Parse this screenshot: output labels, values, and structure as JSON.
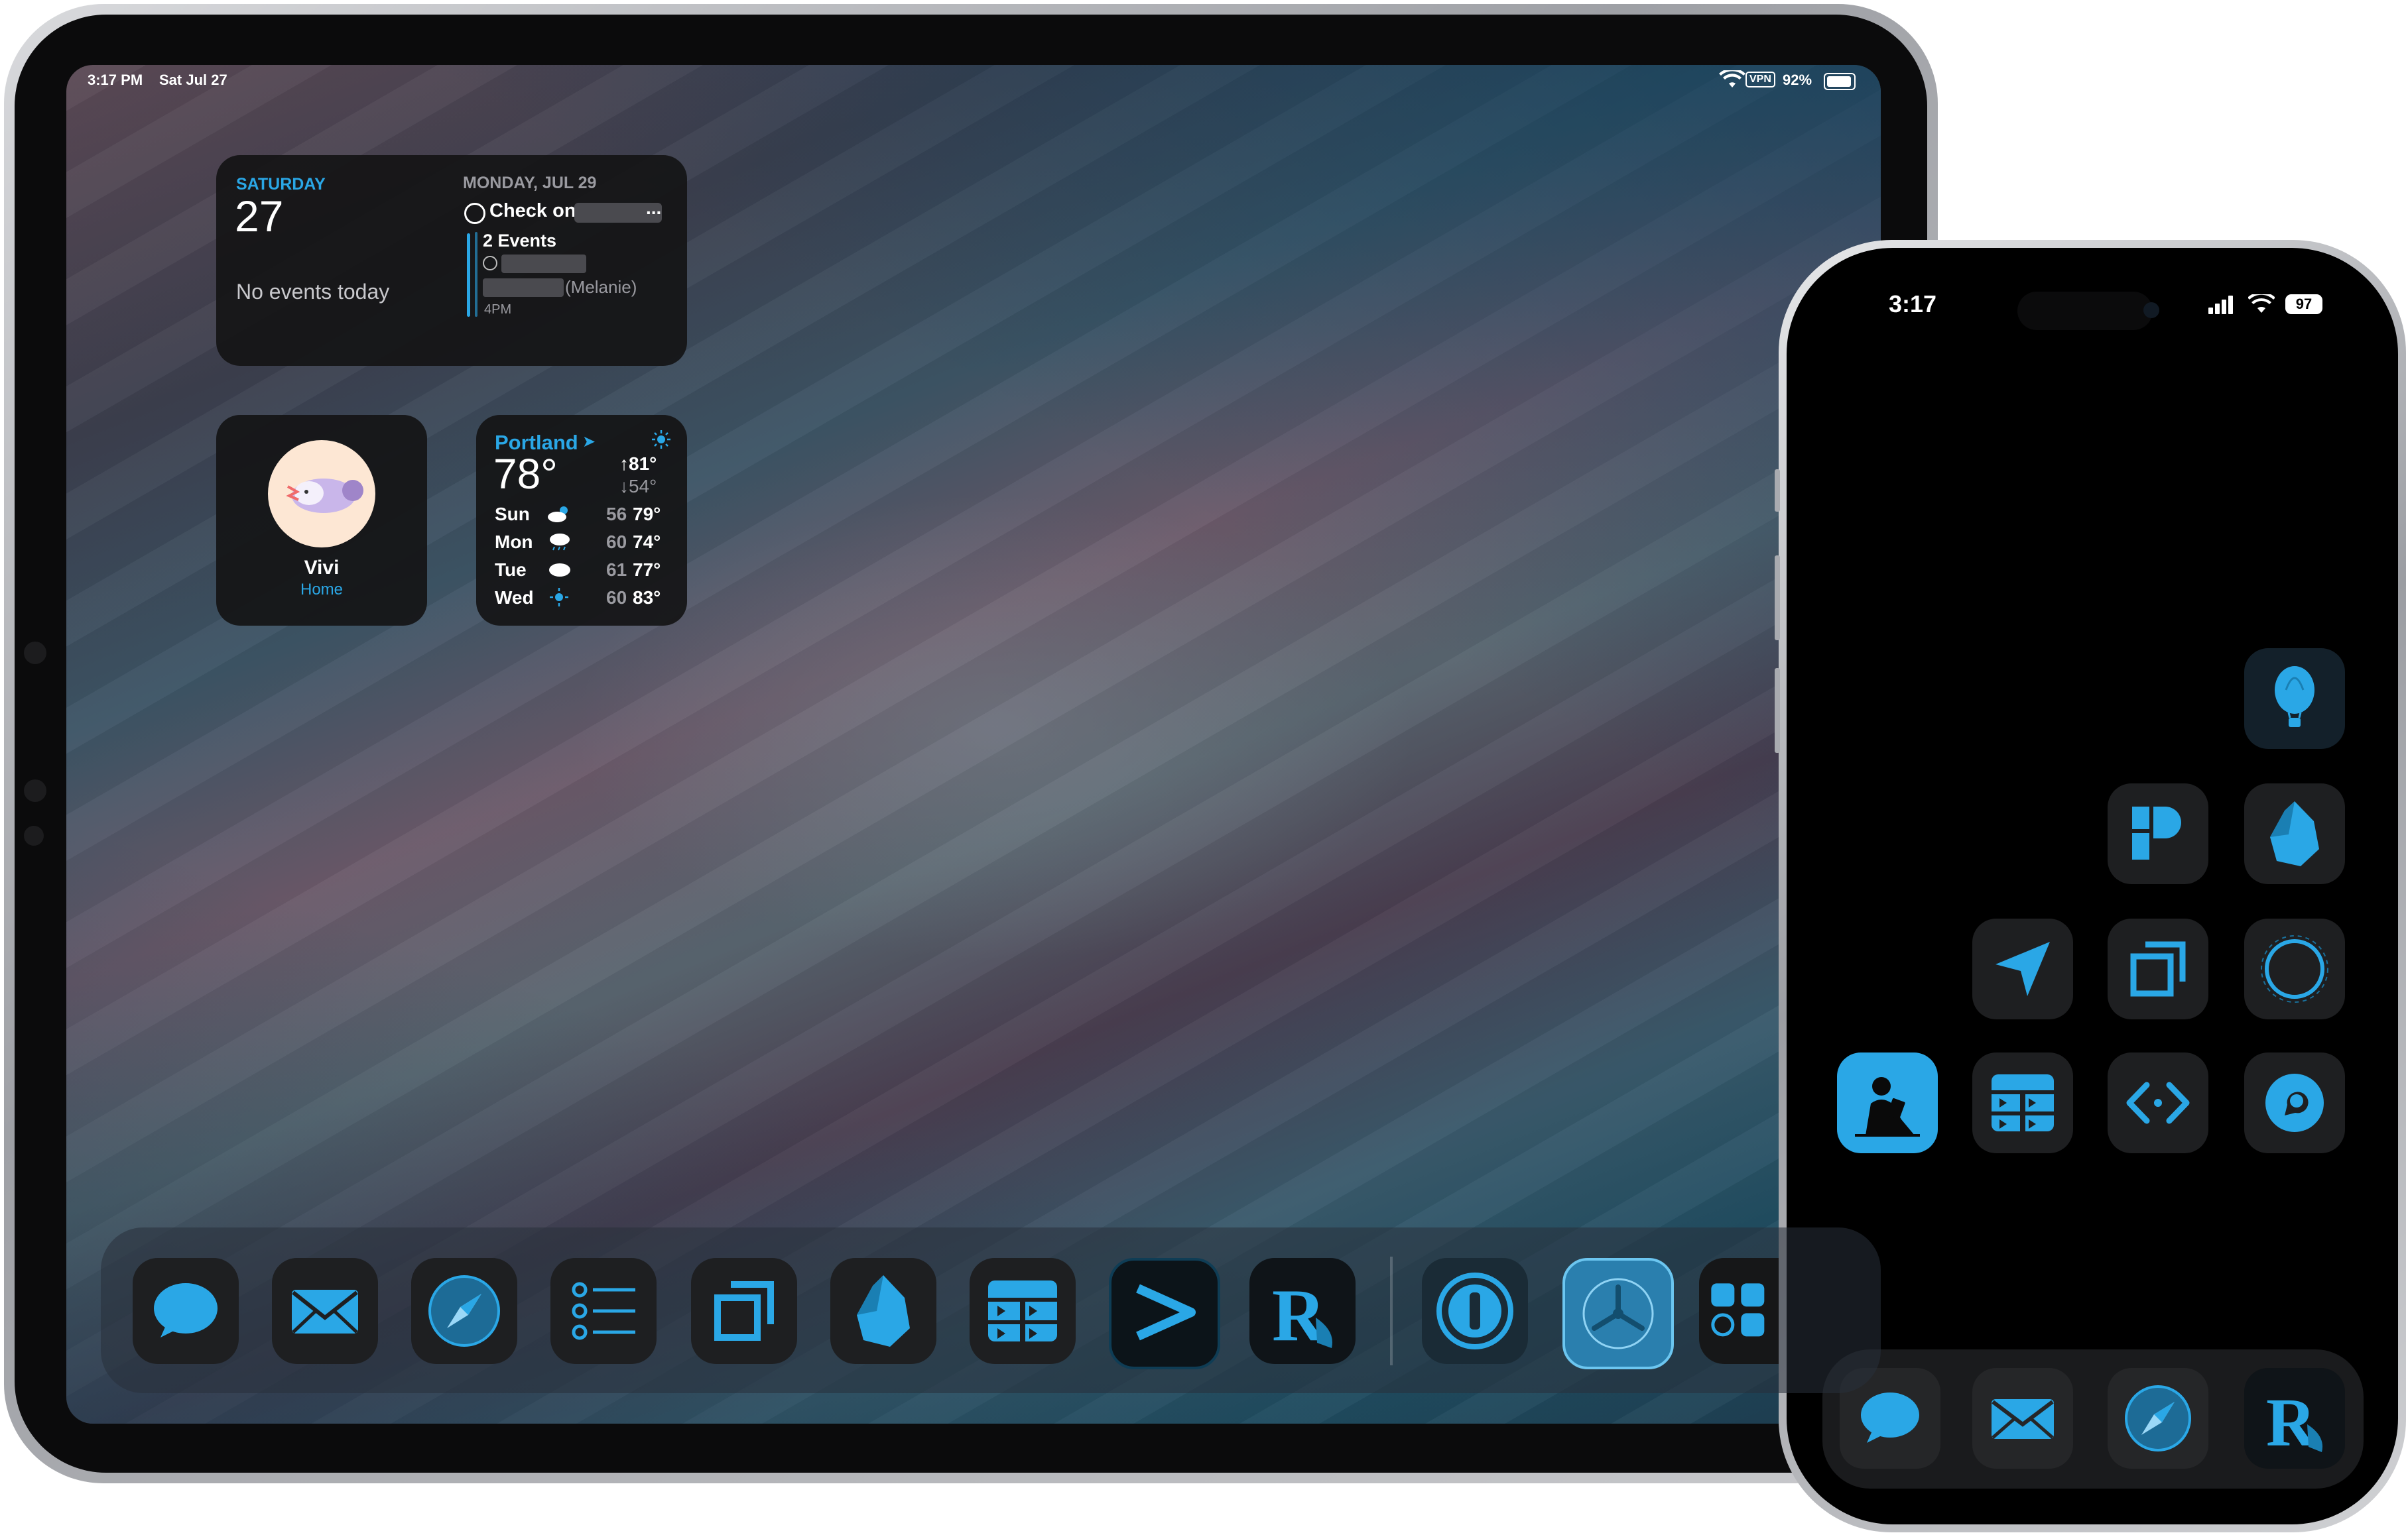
{
  "ipad": {
    "status_bar": {
      "time": "3:17 PM",
      "date": "Sat Jul 27",
      "vpn": "VPN",
      "battery": "92%"
    },
    "calendar_widget": {
      "day_name": "SATURDAY",
      "day_number": "27",
      "no_events": "No events today",
      "next_date": "MONDAY, JUL 29",
      "reminder": "Check on",
      "more": "...",
      "events_count": "2 Events",
      "event_person": "(Melanie)",
      "event_time": "4PM"
    },
    "contact_widget": {
      "name": "Vivi",
      "subtitle": "Home"
    },
    "weather_widget": {
      "city": "Portland",
      "current_temp": "78°",
      "high": "81°",
      "low": "54°",
      "forecast": [
        {
          "day": "Sun",
          "icon": "partly-sunny-icon",
          "low": "56",
          "high": "79°"
        },
        {
          "day": "Mon",
          "icon": "cloud-rain-icon",
          "low": "60",
          "high": "74°"
        },
        {
          "day": "Tue",
          "icon": "cloud-icon",
          "low": "61",
          "high": "77°"
        },
        {
          "day": "Wed",
          "icon": "sun-icon",
          "low": "60",
          "high": "83°"
        }
      ]
    },
    "dock_apps": [
      "Messages",
      "Mail",
      "Safari",
      "Reminders",
      "Screens",
      "Obsidian",
      "Mela",
      "Prompt",
      "Reeder",
      "1Password",
      "Fan",
      "Folder"
    ]
  },
  "iphone": {
    "status_bar": {
      "time": "3:17",
      "battery": "97"
    },
    "apps": [
      "Balloon",
      "Pocket Casts",
      "Obsidian",
      "Maps",
      "Screens",
      "Circle",
      "Kindle",
      "Mela",
      "Code",
      "Messenger"
    ],
    "dock_apps": [
      "Messages",
      "Mail",
      "Safari",
      "Reeder"
    ]
  },
  "colors": {
    "accent": "#2aa7e6",
    "widget_bg": "#141416",
    "icon_bg": "#1e1f21"
  }
}
